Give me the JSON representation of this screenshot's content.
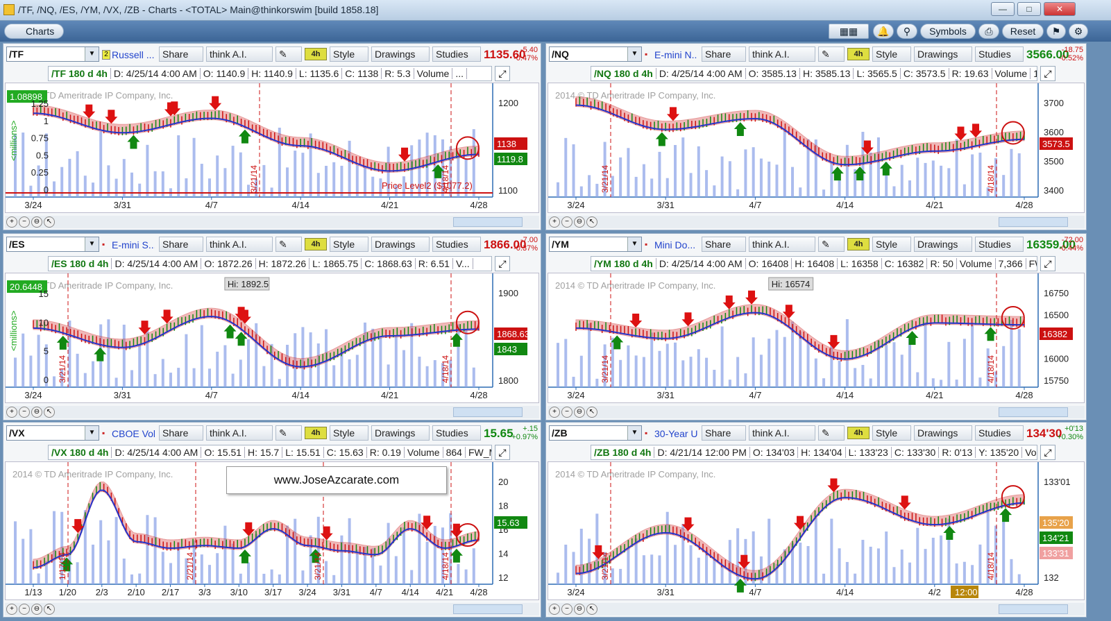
{
  "window": {
    "title": "/TF, /NQ, /ES, /YM, /VX, /ZB - Charts - <TOTAL> Main@thinkorswim [build 1858.18]"
  },
  "toolbar": {
    "charts": "Charts",
    "symbols": "Symbols",
    "reset": "Reset"
  },
  "buttons": {
    "share": "Share",
    "think": "think A.I.",
    "style": "Style",
    "drawings": "Drawings",
    "studies": "Studies",
    "agg": "4h"
  },
  "copyright": "2014 © TD Ameritrade IP Company, Inc.",
  "watermark": "www.JoseAzcarate.com",
  "colors": {
    "up": "#118811",
    "down": "#cc1111",
    "volume": "#8fa6e8",
    "ribbon_up": "#6aa84f",
    "ribbon_down": "#e06666",
    "accent": "#2244cc"
  },
  "panels": [
    {
      "symbol": "/TF",
      "badge": "2",
      "description": "Russell ...",
      "price": "1135.60",
      "change": "-5.40",
      "pct": "-0.47%",
      "price_color": "#cc1111",
      "info": [
        "/TF 180 d 4h",
        "D: 4/25/14 4:00 AM",
        "O: 1140.9",
        "H: 1140.9",
        "L: 1135.6",
        "C: 1138",
        "R: 5.3",
        "Volume",
        "..."
      ],
      "xticks": [
        "3/24",
        "3/31",
        "4/7",
        "4/14",
        "4/21",
        "4/28"
      ],
      "yticks": [
        "1200",
        "1150",
        "1100"
      ],
      "vol_ticks": [
        "1.25",
        "1",
        "0.75",
        "0.5",
        "0.25",
        "0"
      ],
      "vol_label": "<millions>",
      "vol_readout": "1.08898",
      "tags": [
        {
          "text": "1138",
          "color": "#cc1111"
        },
        {
          "text": "1119.8",
          "color": "#118811"
        }
      ],
      "annotations": [
        "Price Level2 ($1077.2)",
        "3/21/14",
        "4/18/14"
      ]
    },
    {
      "symbol": "/NQ",
      "badge": "",
      "description": "E-mini N...",
      "price": "3566.00",
      "change": "-18.75",
      "pct": "-0.52%",
      "price_color": "#118811",
      "info": [
        "/NQ 180 d 4h",
        "D: 4/25/14 4:00 AM",
        "O: 3585.13",
        "H: 3585.13",
        "L: 3565.5",
        "C: 3573.5",
        "R: 19.63",
        "Volume",
        "10,..."
      ],
      "xticks": [
        "3/24",
        "3/31",
        "4/7",
        "4/14",
        "4/21",
        "4/28"
      ],
      "yticks": [
        "3700",
        "3600",
        "3500",
        "3400"
      ],
      "vol_ticks": [],
      "vol_label": "",
      "vol_readout": "",
      "tags": [
        {
          "text": "3573.5",
          "color": "#cc1111"
        }
      ],
      "annotations": [
        "3/21/14",
        "4/18/14"
      ]
    },
    {
      "symbol": "/ES",
      "badge": "",
      "description": "E-mini S...",
      "price": "1866.00",
      "change": "-7.00",
      "pct": "-0.37%",
      "price_color": "#cc1111",
      "info": [
        "/ES 180 d 4h",
        "D: 4/25/14 4:00 AM",
        "O: 1872.26",
        "H: 1872.26",
        "L: 1865.75",
        "C: 1868.63",
        "R: 6.51",
        "V..."
      ],
      "xticks": [
        "3/24",
        "3/31",
        "4/7",
        "4/14",
        "4/21",
        "4/28"
      ],
      "yticks": [
        "1900",
        "1850",
        "1800"
      ],
      "vol_ticks": [
        "15",
        "10",
        "5",
        "0"
      ],
      "vol_label": "<millions>",
      "vol_readout": "20.6448",
      "tags": [
        {
          "text": "1868.63",
          "color": "#cc1111"
        },
        {
          "text": "1843",
          "color": "#118811"
        }
      ],
      "hi": "Hi: 1892.5",
      "annotations": [
        "3/21/14",
        "4/18/14"
      ]
    },
    {
      "symbol": "/YM",
      "badge": "",
      "description": "Mini Do...",
      "price": "16359.00",
      "change": "-72.00",
      "pct": "-0.44%",
      "price_color": "#118811",
      "info": [
        "/YM 180 d 4h",
        "D: 4/25/14 4:00 AM",
        "O: 16408",
        "H: 16408",
        "L: 16358",
        "C: 16382",
        "R: 50",
        "Volume",
        "7,366",
        "FW_..."
      ],
      "xticks": [
        "3/24",
        "3/31",
        "4/7",
        "4/14",
        "4/21",
        "4/28"
      ],
      "yticks": [
        "16750",
        "16500",
        "16250",
        "16000",
        "15750"
      ],
      "vol_ticks": [],
      "vol_label": "",
      "vol_readout": "",
      "tags": [
        {
          "text": "16382",
          "color": "#cc1111"
        }
      ],
      "hi": "Hi: 16574",
      "annotations": [
        "3/21/14",
        "4/18/14"
      ]
    },
    {
      "symbol": "/VX",
      "badge": "",
      "description": "CBOE Vola...",
      "price": "15.65",
      "change": "+.15",
      "pct": "+0.97%",
      "price_color": "#118811",
      "info": [
        "/VX 180 d 4h",
        "D: 4/25/14 4:00 AM",
        "O: 15.51",
        "H: 15.7",
        "L: 15.51",
        "C: 15.63",
        "R: 0.19",
        "Volume",
        "864",
        "FW_MO..."
      ],
      "xticks": [
        "1/13",
        "1/20",
        "2/3",
        "2/10",
        "2/17",
        "3/3",
        "3/10",
        "3/17",
        "3/24",
        "3/31",
        "4/7",
        "4/14",
        "4/21",
        "4/28"
      ],
      "yticks": [
        "20",
        "18",
        "16",
        "14",
        "12"
      ],
      "vol_ticks": [],
      "vol_label": "",
      "vol_readout": "",
      "tags": [
        {
          "text": "15.63",
          "color": "#118811"
        }
      ],
      "annotations": [
        "1/17/14",
        "2/21/14",
        "3/21/14",
        "4/18/14"
      ]
    },
    {
      "symbol": "/ZB",
      "badge": "",
      "description": "30-Year U...",
      "price": "134'30",
      "change": "+0'13",
      "pct": "+0.30%",
      "price_color": "#cc1111",
      "info": [
        "/ZB 180 d 4h",
        "D: 4/21/14 12:00 PM",
        "O: 134'03",
        "H: 134'04",
        "L: 133'23",
        "C: 133'30",
        "R: 0'13",
        "Y: 135'20",
        "Volu..."
      ],
      "xticks": [
        "3/24",
        "3/31",
        "4/7",
        "4/14",
        "4/2",
        "4/28"
      ],
      "yticks": [
        "133'01",
        "132"
      ],
      "vol_ticks": [],
      "vol_label": "",
      "vol_readout": "",
      "tags": [
        {
          "text": "135'20",
          "color": "#e8a24a"
        },
        {
          "text": "134'21",
          "color": "#118811"
        },
        {
          "text": "133'31",
          "color": "#f0a0a0"
        }
      ],
      "cursor_time": "12:00",
      "annotations": [
        "3/21/14",
        "4/18/14"
      ]
    }
  ],
  "chart_data": [
    {
      "type": "line",
      "symbol": "/TF",
      "x": [
        "3/24",
        "3/31",
        "4/7",
        "4/14",
        "4/21",
        "4/28"
      ],
      "series": [
        {
          "values": [
            1195,
            1168,
            1188,
            1150,
            1115,
            1138
          ]
        }
      ],
      "ylim": [
        1075,
        1225
      ]
    },
    {
      "type": "line",
      "symbol": "/NQ",
      "x": [
        "3/24",
        "3/31",
        "4/7",
        "4/14",
        "4/21",
        "4/28"
      ],
      "series": [
        {
          "values": [
            3700,
            3610,
            3650,
            3480,
            3530,
            3573.5
          ]
        }
      ],
      "ylim": [
        3350,
        3750
      ]
    },
    {
      "type": "line",
      "symbol": "/ES",
      "x": [
        "3/24",
        "3/31",
        "4/7",
        "4/14",
        "4/21",
        "4/28"
      ],
      "series": [
        {
          "values": [
            1870,
            1845,
            1885,
            1820,
            1860,
            1868.63
          ]
        }
      ],
      "ylim": [
        1790,
        1930
      ]
    },
    {
      "type": "line",
      "symbol": "/YM",
      "x": [
        "3/24",
        "3/31",
        "4/7",
        "4/14",
        "4/21",
        "4/28"
      ],
      "series": [
        {
          "values": [
            16350,
            16250,
            16500,
            16050,
            16400,
            16382
          ]
        }
      ],
      "ylim": [
        15750,
        16800
      ]
    },
    {
      "type": "line",
      "symbol": "/VX",
      "x": [
        "1/13",
        "1/20",
        "2/3",
        "2/10",
        "2/17",
        "3/3",
        "3/10",
        "3/17",
        "3/24",
        "3/31",
        "4/7",
        "4/14",
        "4/21",
        "4/28"
      ],
      "series": [
        {
          "values": [
            13.5,
            14.5,
            19.5,
            15.5,
            15.0,
            15.2,
            15.0,
            16.5,
            15.2,
            14.8,
            14.5,
            16.5,
            15.0,
            15.63
          ]
        }
      ],
      "ylim": [
        12,
        21
      ]
    },
    {
      "type": "line",
      "symbol": "/ZB",
      "x": [
        "3/24",
        "3/31",
        "4/7",
        "4/14",
        "4/2",
        "4/28"
      ],
      "series": [
        {
          "values": [
            132.0,
            133.5,
            131.8,
            134.8,
            133.8,
            134.6
          ]
        }
      ],
      "ylim": [
        131.5,
        135.8
      ]
    }
  ]
}
